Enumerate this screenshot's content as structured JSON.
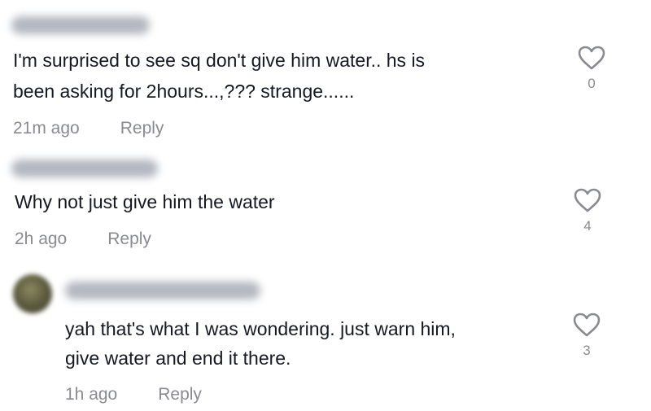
{
  "comments": [
    {
      "text_lines": [
        "I'm surprised to see sq don't give him water.. hs is",
        "been asking for 2hours...,??? strange......"
      ],
      "time": "21m ago",
      "reply_label": "Reply",
      "like_count": "0",
      "like_icon": "heart-outline-icon"
    },
    {
      "text_lines": [
        "Why not just give him the water"
      ],
      "time": "2h ago",
      "reply_label": "Reply",
      "like_count": "4",
      "like_icon": "heart-outline-icon"
    },
    {
      "text_lines": [
        "yah that's what I was wondering. just warn him,",
        "give water and end it there."
      ],
      "time": "1h ago",
      "reply_label": "Reply",
      "like_count": "3",
      "like_icon": "heart-outline-icon"
    }
  ],
  "colors": {
    "text": "#161823",
    "meta": "#8a8b91",
    "icon": "#8a8b91"
  }
}
